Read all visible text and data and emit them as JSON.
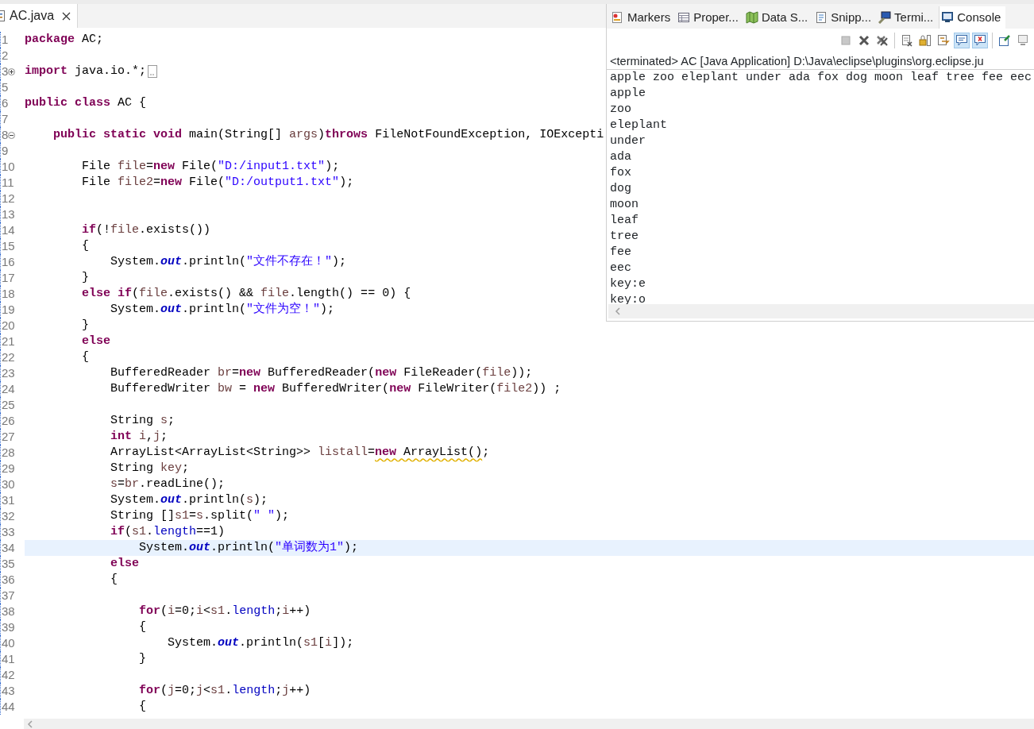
{
  "editor": {
    "tab": {
      "label": "AC.java",
      "selected": true
    },
    "lines": [
      {
        "number": "1",
        "tokens": [
          {
            "kind": "keyword",
            "text": "package"
          },
          {
            "kind": "plain",
            "text": " AC;"
          }
        ]
      },
      {
        "number": "2"
      },
      {
        "number": "3",
        "fold": {
          "collapsed": true
        },
        "tokens": [
          {
            "kind": "keyword",
            "text": "import"
          },
          {
            "kind": "plain",
            "text": " java.io.*;"
          }
        ]
      },
      {
        "number": "5"
      },
      {
        "number": "6",
        "tokens": [
          {
            "kind": "keyword",
            "text": "public class"
          },
          {
            "kind": "plain",
            "text": " AC {"
          }
        ]
      },
      {
        "number": "7"
      },
      {
        "number": "8",
        "fold": {
          "collapsed": false
        },
        "tokens": [
          {
            "kind": "keyword",
            "text": "    public static void"
          },
          {
            "kind": "plain",
            "text": " main(String[] "
          },
          {
            "kind": "variable",
            "text": "args"
          },
          {
            "kind": "plain",
            "text": ")"
          },
          {
            "kind": "keyword",
            "text": "throws"
          },
          {
            "kind": "plain",
            "text": " FileNotFoundException, IOExcepti"
          }
        ]
      },
      {
        "number": "9"
      },
      {
        "number": "10",
        "tokens": [
          {
            "kind": "plain",
            "text": "        File "
          },
          {
            "kind": "variable",
            "text": "file"
          },
          {
            "kind": "plain",
            "text": "="
          },
          {
            "kind": "keyword",
            "text": "new"
          },
          {
            "kind": "plain",
            "text": " File("
          },
          {
            "kind": "string",
            "text": "\"D:/input1.txt\""
          },
          {
            "kind": "plain",
            "text": ");"
          }
        ]
      },
      {
        "number": "11",
        "tokens": [
          {
            "kind": "plain",
            "text": "        File "
          },
          {
            "kind": "variable",
            "text": "file2"
          },
          {
            "kind": "plain",
            "text": "="
          },
          {
            "kind": "keyword",
            "text": "new"
          },
          {
            "kind": "plain",
            "text": " File("
          },
          {
            "kind": "string",
            "text": "\"D:/output1.txt\""
          },
          {
            "kind": "plain",
            "text": ");"
          }
        ]
      },
      {
        "number": "12"
      },
      {
        "number": "13"
      },
      {
        "number": "14",
        "tokens": [
          {
            "kind": "keyword",
            "text": "        if"
          },
          {
            "kind": "plain",
            "text": "(!"
          },
          {
            "kind": "variable",
            "text": "file"
          },
          {
            "kind": "plain",
            "text": ".exists())"
          }
        ]
      },
      {
        "number": "15",
        "tokens": [
          {
            "kind": "plain",
            "text": "        {"
          }
        ]
      },
      {
        "number": "16",
        "tokens": [
          {
            "kind": "plain",
            "text": "            System."
          },
          {
            "kind": "field",
            "text": "out"
          },
          {
            "kind": "plain",
            "text": ".println("
          },
          {
            "kind": "string",
            "text": "\"文件不存在！\""
          },
          {
            "kind": "plain",
            "text": ");"
          }
        ]
      },
      {
        "number": "17",
        "tokens": [
          {
            "kind": "plain",
            "text": "        }"
          }
        ]
      },
      {
        "number": "18",
        "tokens": [
          {
            "kind": "keyword",
            "text": "        else if"
          },
          {
            "kind": "plain",
            "text": "("
          },
          {
            "kind": "variable",
            "text": "file"
          },
          {
            "kind": "plain",
            "text": ".exists() && "
          },
          {
            "kind": "variable",
            "text": "file"
          },
          {
            "kind": "plain",
            "text": ".length() == 0) {"
          }
        ]
      },
      {
        "number": "19",
        "tokens": [
          {
            "kind": "plain",
            "text": "            System."
          },
          {
            "kind": "field",
            "text": "out"
          },
          {
            "kind": "plain",
            "text": ".println("
          },
          {
            "kind": "string",
            "text": "\"文件为空！\""
          },
          {
            "kind": "plain",
            "text": ");"
          }
        ]
      },
      {
        "number": "20",
        "tokens": [
          {
            "kind": "plain",
            "text": "        }"
          }
        ]
      },
      {
        "number": "21",
        "tokens": [
          {
            "kind": "keyword",
            "text": "        else"
          }
        ]
      },
      {
        "number": "22",
        "tokens": [
          {
            "kind": "plain",
            "text": "        {"
          }
        ]
      },
      {
        "number": "23",
        "tokens": [
          {
            "kind": "plain",
            "text": "            BufferedReader "
          },
          {
            "kind": "variable",
            "text": "br"
          },
          {
            "kind": "plain",
            "text": "="
          },
          {
            "kind": "keyword",
            "text": "new"
          },
          {
            "kind": "plain",
            "text": " BufferedReader("
          },
          {
            "kind": "keyword",
            "text": "new"
          },
          {
            "kind": "plain",
            "text": " FileReader("
          },
          {
            "kind": "variable",
            "text": "file"
          },
          {
            "kind": "plain",
            "text": "));"
          }
        ]
      },
      {
        "number": "24",
        "tokens": [
          {
            "kind": "plain",
            "text": "            BufferedWriter "
          },
          {
            "kind": "variable",
            "text": "bw"
          },
          {
            "kind": "plain",
            "text": " = "
          },
          {
            "kind": "keyword",
            "text": "new"
          },
          {
            "kind": "plain",
            "text": " BufferedWriter("
          },
          {
            "kind": "keyword",
            "text": "new"
          },
          {
            "kind": "plain",
            "text": " FileWriter("
          },
          {
            "kind": "variable",
            "text": "file2"
          },
          {
            "kind": "plain",
            "text": ")) ;"
          }
        ]
      },
      {
        "number": "25"
      },
      {
        "number": "26",
        "tokens": [
          {
            "kind": "plain",
            "text": "            String "
          },
          {
            "kind": "variable",
            "text": "s"
          },
          {
            "kind": "plain",
            "text": ";"
          }
        ]
      },
      {
        "number": "27",
        "tokens": [
          {
            "kind": "keyword",
            "text": "            int "
          },
          {
            "kind": "variable",
            "text": "i"
          },
          {
            "kind": "plain",
            "text": ","
          },
          {
            "kind": "variable",
            "text": "j"
          },
          {
            "kind": "plain",
            "text": ";"
          }
        ]
      },
      {
        "number": "28",
        "tokens": [
          {
            "kind": "plain",
            "text": "            ArrayList<ArrayList<String>> "
          },
          {
            "kind": "variable",
            "text": "listall"
          },
          {
            "kind": "plain",
            "text": "="
          },
          {
            "kind": "keyword",
            "text": "new",
            "warning": true
          },
          {
            "kind": "plain",
            "text": " ArrayList()",
            "warning": true
          },
          {
            "kind": "plain",
            "text": ";"
          }
        ]
      },
      {
        "number": "29",
        "tokens": [
          {
            "kind": "plain",
            "text": "            String "
          },
          {
            "kind": "variable",
            "text": "key"
          },
          {
            "kind": "plain",
            "text": ";"
          }
        ]
      },
      {
        "number": "30",
        "tokens": [
          {
            "kind": "variable",
            "text": "            s"
          },
          {
            "kind": "plain",
            "text": "="
          },
          {
            "kind": "variable",
            "text": "br"
          },
          {
            "kind": "plain",
            "text": ".readLine();"
          }
        ]
      },
      {
        "number": "31",
        "tokens": [
          {
            "kind": "plain",
            "text": "            System."
          },
          {
            "kind": "field",
            "text": "out"
          },
          {
            "kind": "plain",
            "text": ".println("
          },
          {
            "kind": "variable",
            "text": "s"
          },
          {
            "kind": "plain",
            "text": ");"
          }
        ]
      },
      {
        "number": "32",
        "tokens": [
          {
            "kind": "plain",
            "text": "            String []"
          },
          {
            "kind": "variable",
            "text": "s1"
          },
          {
            "kind": "plain",
            "text": "="
          },
          {
            "kind": "variable",
            "text": "s"
          },
          {
            "kind": "plain",
            "text": ".split("
          },
          {
            "kind": "string",
            "text": "\" \""
          },
          {
            "kind": "plain",
            "text": ");"
          }
        ]
      },
      {
        "number": "33",
        "tokens": [
          {
            "kind": "keyword",
            "text": "            if"
          },
          {
            "kind": "plain",
            "text": "("
          },
          {
            "kind": "variable",
            "text": "s1"
          },
          {
            "kind": "plain",
            "text": "."
          },
          {
            "kind": "member",
            "text": "length"
          },
          {
            "kind": "plain",
            "text": "==1)"
          }
        ]
      },
      {
        "number": "34",
        "current": true,
        "tokens": [
          {
            "kind": "plain",
            "text": "                System."
          },
          {
            "kind": "field",
            "text": "out"
          },
          {
            "kind": "plain",
            "text": ".println("
          },
          {
            "kind": "string",
            "text": "\"单词数为1\""
          },
          {
            "kind": "plain",
            "text": ");"
          }
        ]
      },
      {
        "number": "35",
        "tokens": [
          {
            "kind": "keyword",
            "text": "            else"
          }
        ]
      },
      {
        "number": "36",
        "tokens": [
          {
            "kind": "plain",
            "text": "            {"
          }
        ]
      },
      {
        "number": "37"
      },
      {
        "number": "38",
        "tokens": [
          {
            "kind": "keyword",
            "text": "                for"
          },
          {
            "kind": "plain",
            "text": "("
          },
          {
            "kind": "variable",
            "text": "i"
          },
          {
            "kind": "plain",
            "text": "=0;"
          },
          {
            "kind": "variable",
            "text": "i"
          },
          {
            "kind": "plain",
            "text": "<"
          },
          {
            "kind": "variable",
            "text": "s1"
          },
          {
            "kind": "plain",
            "text": "."
          },
          {
            "kind": "member",
            "text": "length"
          },
          {
            "kind": "plain",
            "text": ";"
          },
          {
            "kind": "variable",
            "text": "i"
          },
          {
            "kind": "plain",
            "text": "++)"
          }
        ]
      },
      {
        "number": "39",
        "tokens": [
          {
            "kind": "plain",
            "text": "                {"
          }
        ]
      },
      {
        "number": "40",
        "tokens": [
          {
            "kind": "plain",
            "text": "                    System."
          },
          {
            "kind": "field",
            "text": "out"
          },
          {
            "kind": "plain",
            "text": ".println("
          },
          {
            "kind": "variable",
            "text": "s1"
          },
          {
            "kind": "plain",
            "text": "["
          },
          {
            "kind": "variable",
            "text": "i"
          },
          {
            "kind": "plain",
            "text": "]);"
          }
        ]
      },
      {
        "number": "41",
        "tokens": [
          {
            "kind": "plain",
            "text": "                }"
          }
        ]
      },
      {
        "number": "42"
      },
      {
        "number": "43",
        "tokens": [
          {
            "kind": "keyword",
            "text": "                for"
          },
          {
            "kind": "plain",
            "text": "("
          },
          {
            "kind": "variable",
            "text": "j"
          },
          {
            "kind": "plain",
            "text": "=0;"
          },
          {
            "kind": "variable",
            "text": "j"
          },
          {
            "kind": "plain",
            "text": "<"
          },
          {
            "kind": "variable",
            "text": "s1"
          },
          {
            "kind": "plain",
            "text": "."
          },
          {
            "kind": "member",
            "text": "length"
          },
          {
            "kind": "plain",
            "text": ";"
          },
          {
            "kind": "variable",
            "text": "j"
          },
          {
            "kind": "plain",
            "text": "++)"
          }
        ]
      },
      {
        "number": "44",
        "tokens": [
          {
            "kind": "plain",
            "text": "                {"
          }
        ]
      }
    ]
  },
  "console": {
    "tabs": [
      {
        "label": "Markers",
        "selected": false
      },
      {
        "label": "Proper...",
        "selected": false
      },
      {
        "label": "Data S...",
        "selected": false
      },
      {
        "label": "Snipp...",
        "selected": false
      },
      {
        "label": "Termi...",
        "selected": false
      },
      {
        "label": "Console",
        "selected": true
      }
    ],
    "toolbar": [
      {
        "kind": "stop",
        "selected": false
      },
      {
        "kind": "remove",
        "selected": false
      },
      {
        "kind": "remove-all",
        "selected": false
      },
      {
        "kind": "separator"
      },
      {
        "kind": "clear",
        "selected": false
      },
      {
        "kind": "scroll-lock",
        "selected": false
      },
      {
        "kind": "word-wrap",
        "selected": false
      },
      {
        "kind": "show-output",
        "selected": true
      },
      {
        "kind": "show-error",
        "selected": true
      },
      {
        "kind": "separator"
      },
      {
        "kind": "pin",
        "selected": false
      },
      {
        "kind": "display",
        "selected": false
      }
    ],
    "status": "<terminated> AC [Java Application] D:\\Java\\eclipse\\plugins\\org.eclipse.ju",
    "output": [
      "apple zoo eleplant under ada fox dog moon leaf tree fee eec",
      "apple",
      "zoo",
      "eleplant",
      "under",
      "ada",
      "fox",
      "dog",
      "moon",
      "leaf",
      "tree",
      "fee",
      "eec",
      "key:e",
      "key:o"
    ]
  }
}
